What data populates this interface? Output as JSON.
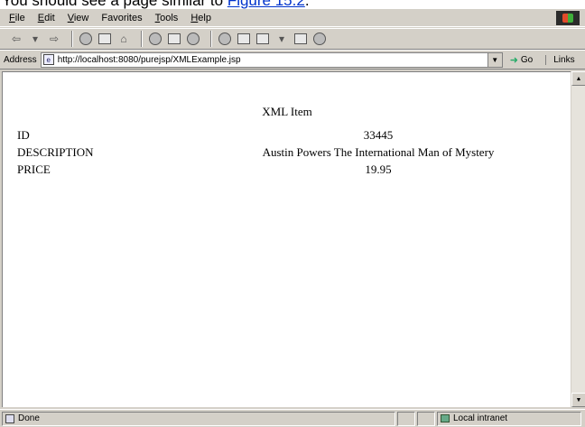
{
  "caption": {
    "prefix": "You should see a page similar to ",
    "link": "Figure 15.2",
    "suffix": "."
  },
  "menu": [
    {
      "label_u": "F",
      "label_rest": "ile"
    },
    {
      "label_u": "E",
      "label_rest": "dit"
    },
    {
      "label_u": "V",
      "label_rest": "iew"
    },
    {
      "label_u": "",
      "label_rest": "Favorites"
    },
    {
      "label_u": "T",
      "label_rest": "ools"
    },
    {
      "label_u": "H",
      "label_rest": "elp"
    }
  ],
  "address": {
    "label": "Address",
    "url": "http://localhost:8080/purejsp/XMLExample.jsp",
    "go": "Go",
    "links": "Links"
  },
  "page": {
    "heading": "XML Item",
    "rows": [
      {
        "label": "ID",
        "value": "33445"
      },
      {
        "label": "DESCRIPTION",
        "value": "Austin Powers The International Man of Mystery"
      },
      {
        "label": "PRICE",
        "value": "19.95"
      }
    ]
  },
  "status": {
    "text": "Done",
    "zone": "Local intranet"
  }
}
